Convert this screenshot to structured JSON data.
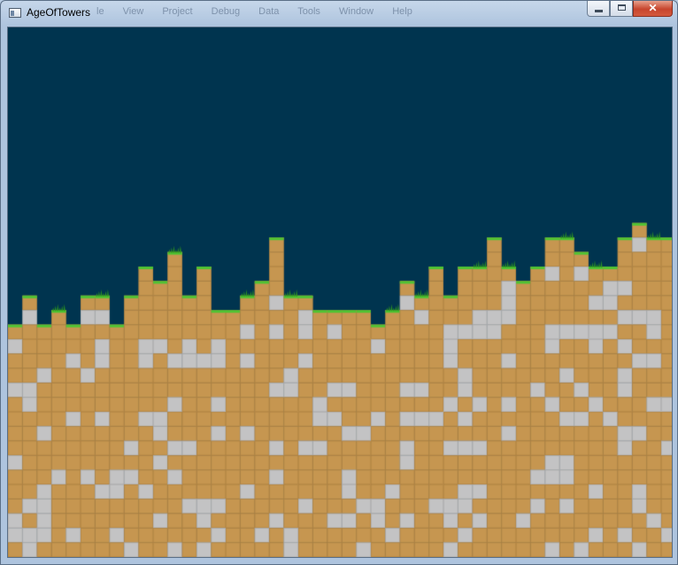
{
  "window": {
    "title": "AgeOfTowers",
    "ghost_menu": [
      "le",
      "View",
      "Project",
      "Debug",
      "Data",
      "Tools",
      "Window",
      "Help"
    ],
    "close_glyph": "✕",
    "icons": {
      "app": "window-icon",
      "minimize": "minimize-icon",
      "maximize": "maximize-icon",
      "close": "close-icon"
    }
  },
  "game": {
    "colors": {
      "sky": "#00344f",
      "dirt": "#c69650",
      "dirt_grid": "#b08342",
      "stone": "#c3c3c4",
      "stone_edge": "#a8a8aa",
      "grass": "#4fc433",
      "grass_tuft": "#2f9a1f"
    },
    "tile_size_px": 16.4,
    "column_heights": [
      16,
      18,
      17,
      17,
      18,
      17,
      16,
      16,
      17,
      17,
      17,
      17,
      18,
      18,
      18,
      16,
      16,
      17,
      17,
      18,
      18,
      17,
      18,
      19,
      18,
      18,
      16,
      16,
      18,
      18,
      18,
      18,
      19,
      20,
      19,
      19,
      17,
      19,
      20,
      20,
      21,
      21,
      17,
      17,
      17,
      18,
      18,
      20,
      20,
      21,
      20,
      20,
      17,
      18,
      18,
      17,
      17,
      18,
      18,
      18,
      19,
      18,
      18,
      19,
      19,
      20,
      21,
      22,
      22,
      21,
      19,
      18,
      19,
      19,
      18,
      18,
      17,
      17,
      17,
      16,
      16,
      17,
      17,
      17,
      17,
      18,
      17,
      18,
      18,
      17,
      17,
      16,
      17,
      16,
      16,
      16,
      17,
      17,
      17,
      18,
      19,
      18,
      18,
      18,
      18,
      17,
      19,
      20,
      20,
      19,
      19,
      18,
      18,
      19,
      19,
      20,
      20,
      21,
      21,
      20,
      20,
      21,
      21,
      22,
      22,
      20,
      20,
      20,
      20,
      19,
      19,
      20,
      20,
      20,
      20,
      21,
      21,
      22,
      22,
      21,
      21,
      22,
      22,
      22,
      22,
      21,
      21,
      20,
      20,
      20,
      20,
      20,
      20,
      20,
      20,
      21,
      22,
      22,
      22,
      22,
      23,
      23,
      21,
      20,
      22,
      23,
      23,
      22,
      22,
      21,
      21
    ],
    "stone_density": 0.24,
    "grass_tuft_columns": [
      3,
      6,
      11,
      16,
      19,
      26,
      28,
      32,
      34,
      38,
      40,
      44
    ]
  }
}
